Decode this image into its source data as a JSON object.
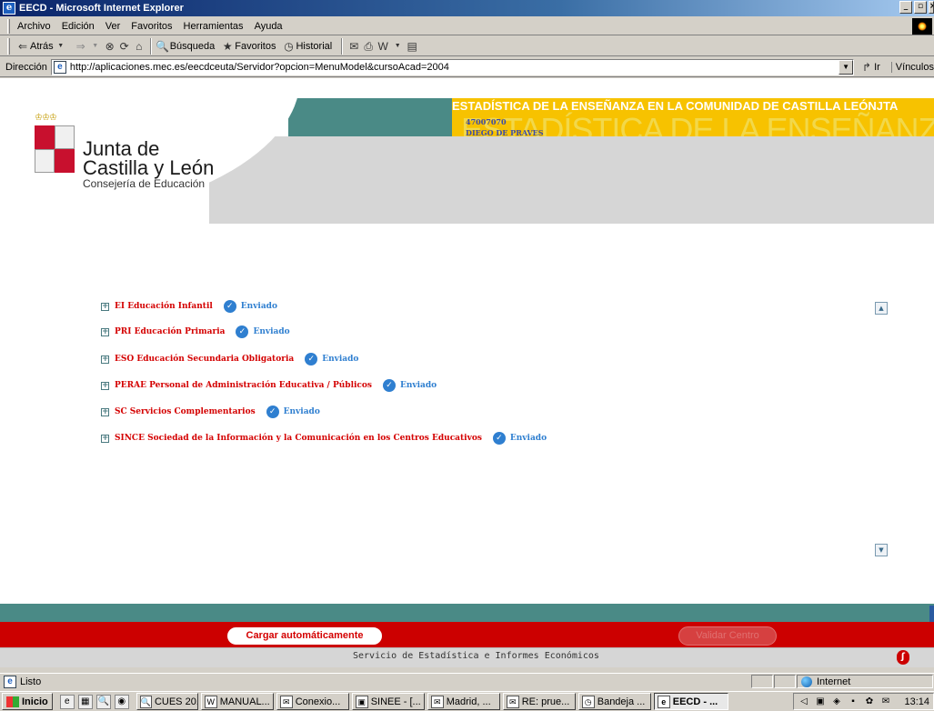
{
  "window": {
    "title": "EECD - Microsoft Internet Explorer",
    "controls": {
      "minimize": "_",
      "maximize": "8",
      "close": "x"
    }
  },
  "menubar": {
    "items": [
      "Archivo",
      "Edición",
      "Ver",
      "Favoritos",
      "Herramientas",
      "Ayuda"
    ]
  },
  "toolbar": {
    "back": "Atrás",
    "search": "Búsqueda",
    "favorites": "Favoritos",
    "history": "Historial"
  },
  "addressbar": {
    "label": "Dirección",
    "url": "http://aplicaciones.mec.es/eecdceuta/Servidor?opcion=MenuModel&cursoAcad=2004",
    "go": "Ir",
    "links": "Vínculos"
  },
  "header": {
    "banner_title": "ESTADÍSTICA DE LA ENSEÑANZA EN LA COMUNIDAD DE CASTILLA LEÓN",
    "banner_suffix": "JTA",
    "ghost_text": "ESTADÍSTICA DE LA ENSEÑANZA EN LA COMUNIDAD DE CASTILLA LEÓN",
    "center_code": "47007070",
    "center_name": "DIEGO DE PRAVES",
    "logo_line1": "Junta de",
    "logo_line2": "Castilla y León",
    "logo_sub": "Consejería de Educación"
  },
  "menu": {
    "rows": [
      {
        "label": "EI Educación Infantil",
        "status": "Enviado"
      },
      {
        "label": "PRI Educación Primaria",
        "status": "Enviado"
      },
      {
        "label": "ESO Educación Secundaria Obligatoria",
        "status": "Enviado"
      },
      {
        "label": "PERAE Personal de Administración Educativa / Públicos",
        "status": "Enviado"
      },
      {
        "label": "SC Servicios Complementarios",
        "status": "Enviado"
      },
      {
        "label": "SINCE Sociedad de la Información y la Comunicación en los Centros Educativos",
        "status": "Enviado"
      }
    ]
  },
  "actions": {
    "cargar": "Cargar automáticamente",
    "validar": "Validar Centro"
  },
  "footer": {
    "text": "Servicio de Estadística e Informes Económicos"
  },
  "statusbar": {
    "status": "Listo",
    "zone": "Internet"
  },
  "taskbar": {
    "start": "Inicio",
    "tasks": [
      "CUES 20...",
      "MANUAL...",
      "Conexio...",
      "SINEE - [...",
      "Madrid, ...",
      "RE: prue...",
      "Bandeja ...",
      "EECD - ..."
    ],
    "clock": "13:14"
  },
  "colors": {
    "accent_red": "#cc0000",
    "label_red": "#d40000",
    "status_blue": "#2f7fd0",
    "teal": "#4a8a86",
    "banner_yellow": "#f7c200"
  }
}
